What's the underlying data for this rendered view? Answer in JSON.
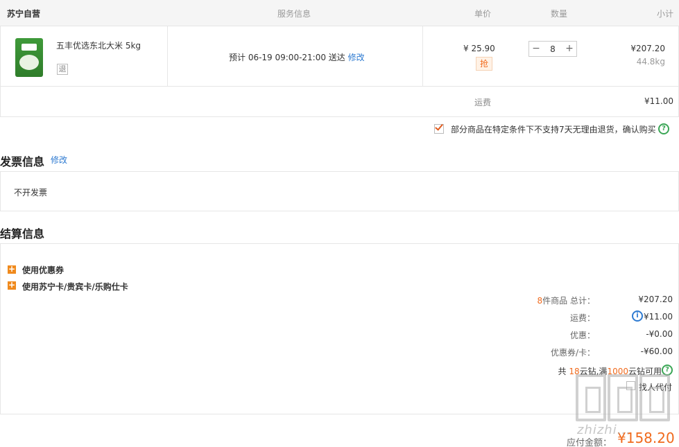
{
  "header": {
    "store": "苏宁自营",
    "service": "服务信息",
    "unit_price": "单价",
    "quantity": "数量",
    "subtotal": "小计"
  },
  "product": {
    "name": "五丰优选东北大米 5kg",
    "return_badge": "退",
    "delivery_prefix": "预计 06-19 09:00-21:00 送达",
    "delivery_modify": "修改",
    "price": "¥ 25.90",
    "flash_tag": "抢",
    "qty": "8",
    "qty_minus": "−",
    "qty_plus": "+",
    "subtotal": "¥207.20",
    "weight": "44.8kg",
    "image_icon": "rice-bag-image"
  },
  "shipping": {
    "label": "运费",
    "value": "¥11.00"
  },
  "agreement": {
    "text": "部分商品在特定条件下不支持7天无理由退货，确认购买",
    "checked": true
  },
  "invoice": {
    "title": "发票信息",
    "modify": "修改",
    "value": "不开发票"
  },
  "settlement": {
    "title": "结算信息",
    "coupon_label": "使用优惠券",
    "card_label": "使用苏宁卡/贵宾卡/乐购仕卡",
    "count": "8",
    "count_suffix": "件商品 总计：",
    "total": "¥207.20",
    "freight_label": "运费：",
    "freight": "¥11.00",
    "discount_label": "优惠：",
    "discount": "-¥0.00",
    "coupon_card_label": "优惠券/卡：",
    "coupon_card": "-¥60.00",
    "diamond_prefix": "共",
    "diamond_count": "18",
    "diamond_mid": "云钻,满",
    "diamond_threshold": "1000",
    "diamond_suffix": "云钻可用",
    "proxy_pay": "找人代付"
  },
  "payable": {
    "label": "应付金额：",
    "value": "¥158.20"
  },
  "watermark": {
    "text": "zhizhi..."
  },
  "colors": {
    "accent": "#f06a1d",
    "link": "#2d7ad1",
    "help": "#3aa655"
  }
}
